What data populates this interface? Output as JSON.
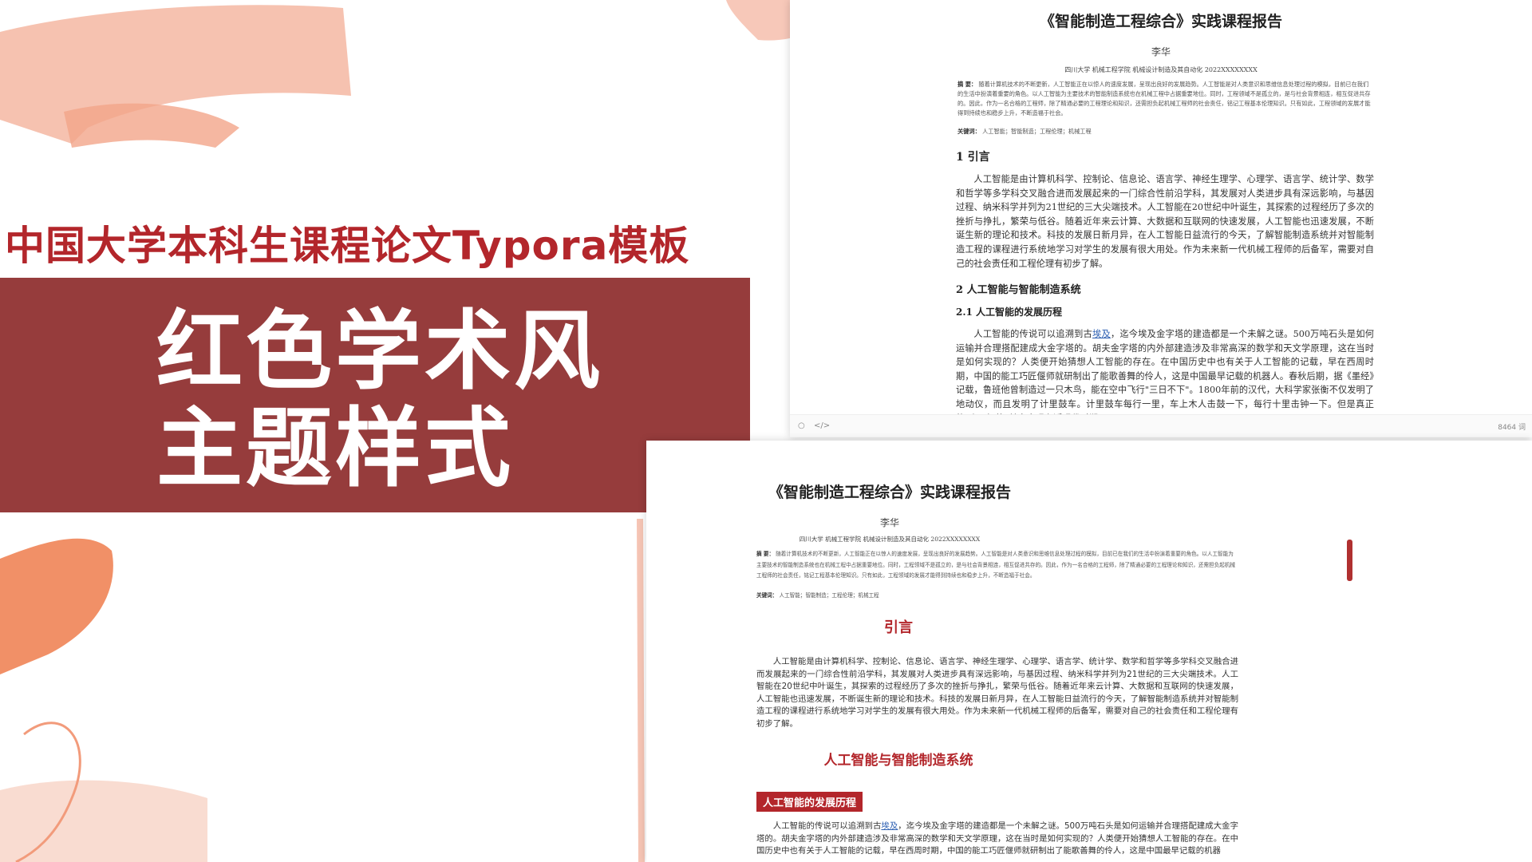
{
  "colors": {
    "accent_red": "#b3262b",
    "panel_red": "#963c3c",
    "salmon": "#f2a58a",
    "peach": "#f7c8b6"
  },
  "promo": {
    "headline": "中国大学本科生课程论文Typora模板",
    "panel_line1": "红色学术风",
    "panel_line2": "主题样式"
  },
  "doc1": {
    "title": "《智能制造工程综合》实践课程报告",
    "author": "李华",
    "affiliation": "四川大学 机械工程学院 机械设计制造及其自动化 2022XXXXXXXX",
    "abstract_label": "摘 要：",
    "abstract_text": "随着计算机技术的不断更新，人工智能正在以惊人的速度发展，呈现出良好的发展趋势。人工智能是对人类意识和思维信息处理过程的模拟，目前已在我们的生活中扮演着重要的角色。以人工智能为主要技术的智能制造系统也在机械工程中占据重要地位。同时，工程领域不是孤立的，是与社会背景相连，相互促进共存的。因此，作为一名合格的工程师，除了精通必要的工程理论和知识，还需担负起机械工程师的社会责任，铭记工程基本伦理知识。只有如此，工程领域的发展才能得到持续也和稳步上升，不断造福于社会。",
    "keywords_label": "关键词：",
    "keywords_text": "人工智能；智能制造；工程伦理；机械工程",
    "h1_intro": "1 引言",
    "para_intro": "人工智能是由计算机科学、控制论、信息论、语言学、神经生理学、心理学、语言学、统计学、数学和哲学等多学科交叉融合进而发展起来的一门综合性前沿学科，其发展对人类进步具有深远影响，与基因过程、纳米科学并列为21世纪的三大尖端技术。人工智能在20世纪中叶诞生，其探索的过程经历了多次的挫折与挣扎，繁荣与低谷。随着近年来云计算、大数据和互联网的快速发展，人工智能也迅速发展，不断诞生新的理论和技术。科技的发展日新月异，在人工智能日益流行的今天，了解智能制造系统并对智能制造工程的课程进行系统地学习对学生的发展有很大用处。作为未来新一代机械工程师的后备军，需要对自己的社会责任和工程伦理有初步了解。",
    "h1_ai": "2 人工智能与智能制造系统",
    "h2_history": "2.1 人工智能的发展历程",
    "para_history_pre": "人工智能的传说可以追溯到古",
    "para_history_link": "埃及",
    "para_history_post": "，迄今埃及金字塔的建造都是一个未解之谜。500万吨石头是如何运输并合理搭配建成大金字塔的。胡夫金字塔的内外部建造涉及非常高深的数学和天文学原理，这在当时是如何实现的？人类便开始猜想人工智能的存在。在中国历史中也有关于人工智能的记载，早在西周时期，中国的能工巧匠偃师就研制出了能歌善舞的伶人，这是中国最早记载的机器人。春秋后期，据《墨经》记载，鲁班他曾制造过一只木鸟，能在空中飞行\"三日不下\"。1800年前的汉代，大科学家张衡不仅发明了地动仪，而且发明了计里鼓车。计里鼓车每行一里，车上木人击鼓一下，每行十里击钟一下。但是真正的\"人工智能\"其实出现在近现代时期。",
    "status_left_icon": "○",
    "status_code_icon": "</>",
    "word_count": "8464 词"
  },
  "doc2": {
    "title": "《智能制造工程综合》实践课程报告",
    "author": "李华",
    "affiliation": "四川大学 机械工程学院 机械设计制造及其自动化 2022XXXXXXXX",
    "abstract_label": "摘 要：",
    "abstract_text": "随着计算机技术的不断更新，人工智能正在以惊人的速度发展，呈现出良好的发展趋势。人工智能是对人类意识和思维信息处理过程的模拟，目前已在我们的生活中扮演着重要的角色。以人工智能为主要技术的智能制造系统也在机械工程中占据重要地位。同时，工程领域不是孤立的，是与社会背景相连，相互促进共存的。因此，作为一名合格的工程师，除了精通必要的工程理论和知识，还需担负起机械工程师的社会责任，铭记工程基本伦理知识。只有如此，工程领域的发展才能得到持续也和稳步上升，不断造福于社会。",
    "keywords_label": "关键词：",
    "keywords_text": "人工智能；智能制造；工程伦理；机械工程",
    "h1_intro": "引言",
    "para_intro": "人工智能是由计算机科学、控制论、信息论、语言学、神经生理学、心理学、语言学、统计学、数学和哲学等多学科交叉融合进而发展起来的一门综合性前沿学科，其发展对人类进步具有深远影响，与基因过程、纳米科学并列为21世纪的三大尖端技术。人工智能在20世纪中叶诞生，其探索的过程经历了多次的挫折与挣扎，繁荣与低谷。随着近年来云计算、大数据和互联网的快速发展，人工智能也迅速发展，不断诞生新的理论和技术。科技的发展日新月异，在人工智能日益流行的今天，了解智能制造系统并对智能制造工程的课程进行系统地学习对学生的发展有很大用处。作为未来新一代机械工程师的后备军，需要对自己的社会责任和工程伦理有初步了解。",
    "h1_ai": "人工智能与智能制造系统",
    "h2_history": "人工智能的发展历程",
    "para_history_pre": "人工智能的传说可以追溯到古",
    "para_history_link": "埃及",
    "para_history_post": "，迄今埃及金字塔的建造都是一个未解之谜。500万吨石头是如何运输并合理搭配建成大金字塔的。胡夫金字塔的内外部建造涉及非常高深的数学和天文学原理，这在当时是如何实现的？人类便开始猜想人工智能的存在。在中国历史中也有关于人工智能的记载，早在西周时期，中国的能工巧匠偃师就研制出了能歌善舞的伶人，这是中国最早记载的机器"
  }
}
